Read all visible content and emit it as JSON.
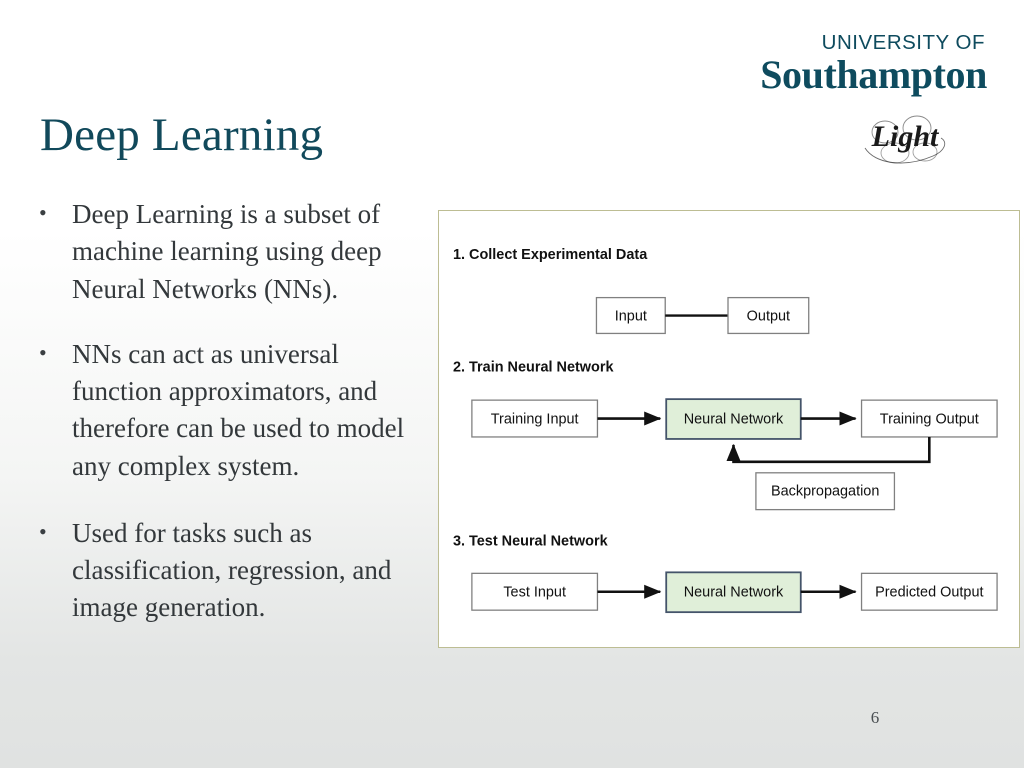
{
  "slide": {
    "title": "Deep Learning",
    "number": "6",
    "background_top": "#ffffff",
    "background_bottom": "#e0e2e1",
    "title_color": "#11495B"
  },
  "logos": {
    "university": {
      "line1": "UNIVERSITY OF",
      "line2": "Southampton",
      "color": "#0E4B5E"
    },
    "light": {
      "text": "Light"
    }
  },
  "bullets": [
    {
      "marker": "•",
      "text": "Deep Learning is a subset of machine learning using deep Neural Networks (NNs)."
    },
    {
      "marker": "•",
      "text": "NNs can act as universal function approximators, and therefore can be used to model any complex system."
    },
    {
      "marker": "•",
      "text": "Used for tasks such as classification, regression, and image generation."
    }
  ],
  "diagram": {
    "border_color": "#BDBD93",
    "accent_fill": "#E0EFD9",
    "accent_stroke": "#44546A",
    "sections": [
      {
        "heading": "1. Collect Experimental Data",
        "nodes": [
          {
            "label": "Input",
            "highlight": false
          },
          {
            "label": "Output",
            "highlight": false
          }
        ],
        "connector": "line"
      },
      {
        "heading": "2. Train Neural Network",
        "nodes": [
          {
            "label": "Training Input",
            "highlight": false
          },
          {
            "label": "Neural Network",
            "highlight": true
          },
          {
            "label": "Training Output",
            "highlight": false
          },
          {
            "label": "Backpropagation",
            "highlight": false
          }
        ],
        "connector": "arrow-with-feedback-loop"
      },
      {
        "heading": "3. Test Neural Network",
        "nodes": [
          {
            "label": "Test Input",
            "highlight": false
          },
          {
            "label": "Neural Network",
            "highlight": true
          },
          {
            "label": "Predicted Output",
            "highlight": false
          }
        ],
        "connector": "arrow"
      }
    ]
  }
}
